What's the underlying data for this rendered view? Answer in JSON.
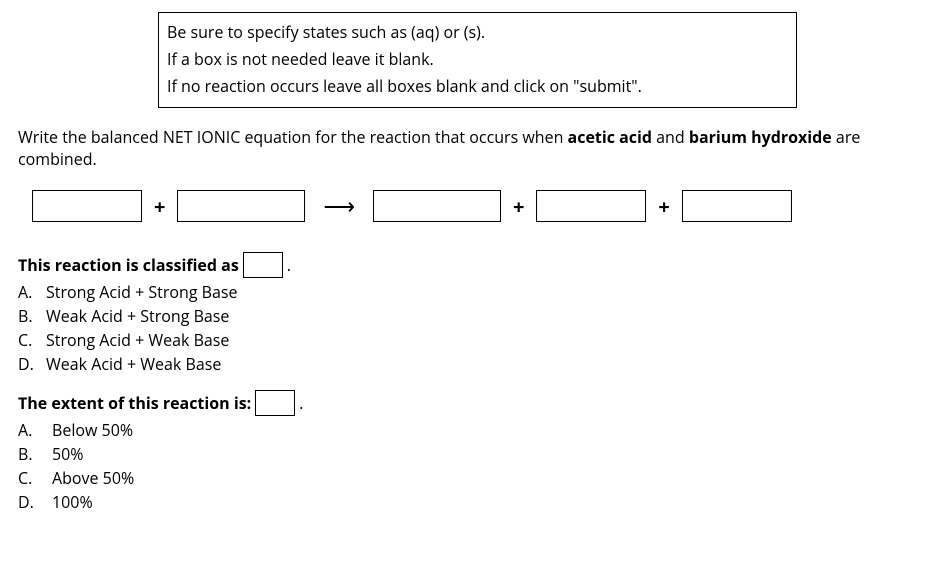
{
  "instructions": {
    "line1": "Be sure to specify states such as (aq) or (s).",
    "line2": "If a box is not needed leave it blank.",
    "line3": "If no reaction occurs leave all boxes blank and click on \"submit\"."
  },
  "prompt": {
    "lead": "Write the balanced NET IONIC equation for the reaction that occurs when ",
    "reagent1": "acetic acid",
    "mid": " and ",
    "reagent2": "barium hydroxide",
    "tail": " are combined."
  },
  "equation": {
    "plus": "+",
    "arrow": "⟶"
  },
  "classification": {
    "label_lead": "This reaction is classified as",
    "period": ".",
    "options": {
      "A": "Strong Acid + Strong Base",
      "B": "Weak Acid + Strong Base",
      "C": "Strong Acid + Weak Base",
      "D": "Weak Acid + Weak Base"
    }
  },
  "extent": {
    "label_lead": "The extent of this reaction is:",
    "period": ".",
    "options": {
      "A": "Below 50%",
      "B": "50%",
      "C": "Above 50%",
      "D": "100%"
    }
  },
  "letters": {
    "A": "A.",
    "B": "B.",
    "C": "C.",
    "D": "D."
  }
}
